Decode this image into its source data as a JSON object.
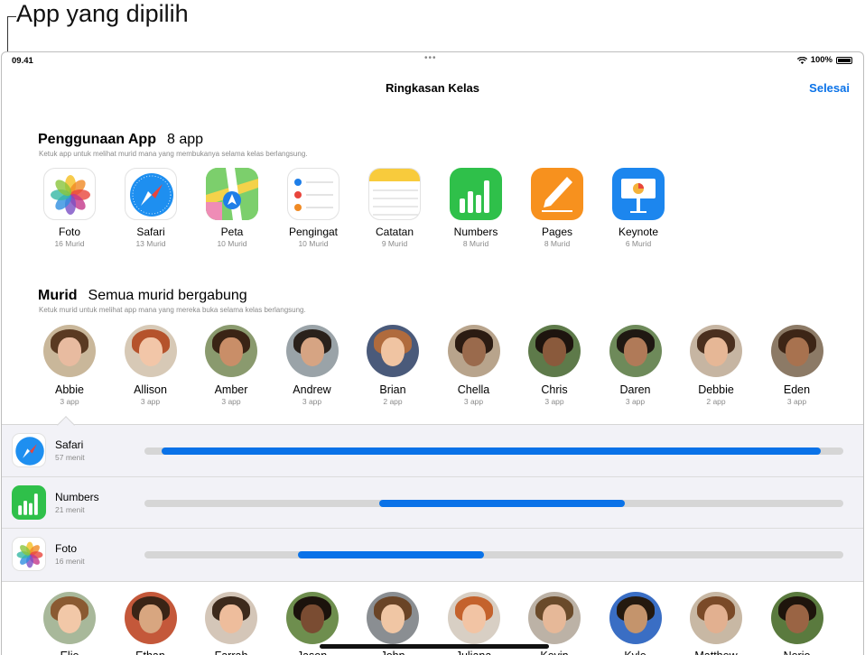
{
  "callout": {
    "label": "App yang dipilih"
  },
  "status_bar": {
    "time": "09.41",
    "battery": "100%"
  },
  "nav": {
    "title": "Ringkasan Kelas",
    "done_label": "Selesai"
  },
  "app_usage": {
    "title": "Penggunaan App",
    "count": "8 app",
    "subtitle": "Ketuk app untuk melihat murid mana yang membukanya selama kelas berlangsung.",
    "apps": [
      {
        "name": "Foto",
        "students": "16 Murid",
        "icon": "photos-icon"
      },
      {
        "name": "Safari",
        "students": "13 Murid",
        "icon": "safari-icon"
      },
      {
        "name": "Peta",
        "students": "10 Murid",
        "icon": "maps-icon"
      },
      {
        "name": "Pengingat",
        "students": "10 Murid",
        "icon": "reminders-icon"
      },
      {
        "name": "Catatan",
        "students": "9 Murid",
        "icon": "notes-icon"
      },
      {
        "name": "Numbers",
        "students": "8 Murid",
        "icon": "numbers-icon"
      },
      {
        "name": "Pages",
        "students": "8 Murid",
        "icon": "pages-icon"
      },
      {
        "name": "Keynote",
        "students": "6 Murid",
        "icon": "keynote-icon"
      }
    ]
  },
  "students_section": {
    "title": "Murid",
    "status": "Semua murid bergabung",
    "subtitle": "Ketuk murid untuk melihat app mana yang mereka buka selama kelas berlangsung.",
    "students": [
      {
        "name": "Abbie",
        "apps": "3 app",
        "skin": "#e8bba0",
        "hair": "#5a3a22",
        "bg": "#c9b79a"
      },
      {
        "name": "Allison",
        "apps": "3 app",
        "skin": "#f2c6a8",
        "hair": "#b5532c",
        "bg": "#d7c9b6"
      },
      {
        "name": "Amber",
        "apps": "3 app",
        "skin": "#c98e68",
        "hair": "#3a2415",
        "bg": "#8a9a6e"
      },
      {
        "name": "Andrew",
        "apps": "3 app",
        "skin": "#d6a483",
        "hair": "#2a211b",
        "bg": "#9aa3a8"
      },
      {
        "name": "Brian",
        "apps": "2 app",
        "skin": "#f0c4a2",
        "hair": "#b06b3d",
        "bg": "#4a5a7a"
      },
      {
        "name": "Chella",
        "apps": "3 app",
        "skin": "#9a6a4c",
        "hair": "#2b1b12",
        "bg": "#b8a48c"
      },
      {
        "name": "Chris",
        "apps": "3 app",
        "skin": "#8a5a3c",
        "hair": "#1d140e",
        "bg": "#5e7a4a"
      },
      {
        "name": "Daren",
        "apps": "3 app",
        "skin": "#b07a58",
        "hair": "#1f1812",
        "bg": "#6e8a5a"
      },
      {
        "name": "Debbie",
        "apps": "2 app",
        "skin": "#e6b796",
        "hair": "#4a2f1e",
        "bg": "#c6b5a2"
      },
      {
        "name": "Eden",
        "apps": "3 app",
        "skin": "#a8724f",
        "hair": "#3d2516",
        "bg": "#8c7a66"
      }
    ]
  },
  "selected_student_usage": [
    {
      "app": "Safari",
      "duration": "57 menit",
      "icon": "safari-icon",
      "bar_start": 0.025,
      "bar_end": 0.968
    },
    {
      "app": "Numbers",
      "duration": "21 menit",
      "icon": "numbers-icon",
      "bar_start": 0.336,
      "bar_end": 0.687
    },
    {
      "app": "Foto",
      "duration": "16 menit",
      "icon": "photos-icon",
      "bar_start": 0.219,
      "bar_end": 0.486
    }
  ],
  "more_students": [
    {
      "name": "Elie",
      "skin": "#f2c8a8",
      "hair": "#8a5a32",
      "bg": "#a8b89a"
    },
    {
      "name": "Ethan",
      "skin": "#d8a680",
      "hair": "#3a2416",
      "bg": "#c4583a"
    },
    {
      "name": "Farrah",
      "skin": "#eebd9c",
      "hair": "#3d2a1c",
      "bg": "#d4c6b8"
    },
    {
      "name": "Jason",
      "skin": "#7a4c32",
      "hair": "#1b120c",
      "bg": "#6e8e4e"
    },
    {
      "name": "John",
      "skin": "#f0c6a4",
      "hair": "#6a4426",
      "bg": "#8a8e92"
    },
    {
      "name": "Juliana",
      "skin": "#f2c4a4",
      "hair": "#c4622c",
      "bg": "#d8cfc4"
    },
    {
      "name": "Kevin",
      "skin": "#e6b898",
      "hair": "#6a4a2a",
      "bg": "#bcb2a6"
    },
    {
      "name": "Kyle",
      "skin": "#c4946c",
      "hair": "#24190f",
      "bg": "#3a6ec4"
    },
    {
      "name": "Matthew",
      "skin": "#e2b090",
      "hair": "#7a4a28",
      "bg": "#c8b8a4"
    },
    {
      "name": "Nerio",
      "skin": "#9a6444",
      "hair": "#1e140c",
      "bg": "#5a7a3e"
    }
  ]
}
